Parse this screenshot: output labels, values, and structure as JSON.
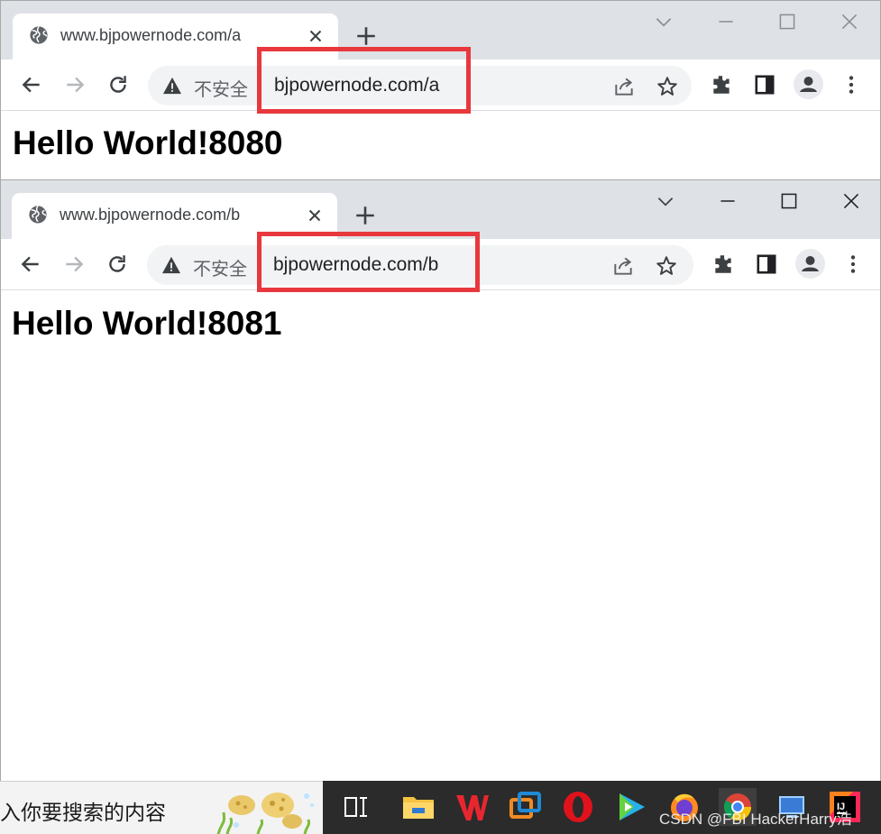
{
  "windows": [
    {
      "tab_title": "www.bjpowernode.com/a",
      "url": "bjpowernode.com/a",
      "security_label": "不安全",
      "heading": "Hello World!8080"
    },
    {
      "tab_title": "www.bjpowernode.com/b",
      "url": "bjpowernode.com/b",
      "security_label": "不安全",
      "heading": "Hello World!8081"
    }
  ],
  "colors": {
    "highlight": "#e8383d",
    "titlebar": "#dee1e6",
    "omnibox": "#f1f3f4",
    "taskbar": "#2b2b2b"
  },
  "icons": {
    "tab": [
      "globe-icon",
      "close-icon",
      "plus-icon"
    ],
    "window_controls": [
      "chevron-down-icon",
      "minimize-icon",
      "maximize-icon",
      "close-window-icon"
    ],
    "toolbar": [
      "back-arrow-icon",
      "forward-arrow-icon",
      "reload-icon",
      "warning-icon",
      "share-icon",
      "star-icon",
      "extensions-icon",
      "side-panel-icon",
      "profile-icon",
      "kebab-menu-icon"
    ],
    "taskbar": [
      "task-view-icon",
      "file-explorer-icon",
      "wps-icon",
      "remote-desktop-icon",
      "opera-icon",
      "video-player-icon",
      "firefox-icon",
      "chrome-icon",
      "monitor-icon",
      "intellij-icon"
    ]
  },
  "taskbar": {
    "search_text": "入你要搜索的内容",
    "watermark": "CSDN @FBI HackerHarry浩"
  }
}
